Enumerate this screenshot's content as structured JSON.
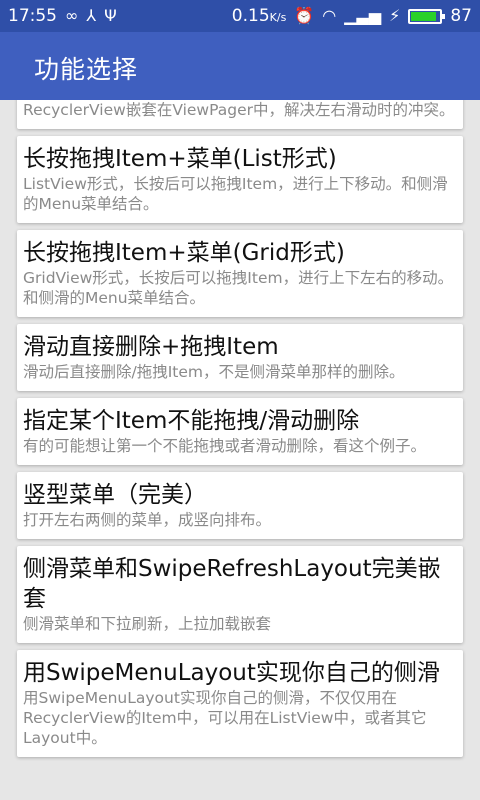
{
  "status_bar": {
    "time": "17:55",
    "net_speed": "0.15",
    "net_unit": "K/s",
    "battery_level": "87",
    "battery_fraction": 0.87
  },
  "toolbar": {
    "title": "功能选择"
  },
  "items": [
    {
      "title": "",
      "desc": "RecyclerView嵌套在ViewPager中，解决左右滑动时的冲突。"
    },
    {
      "title": "长按拖拽Item+菜单(List形式)",
      "desc": "ListView形式，长按后可以拖拽Item，进行上下移动。和侧滑的Menu菜单结合。"
    },
    {
      "title": "长按拖拽Item+菜单(Grid形式)",
      "desc": "GridView形式，长按后可以拖拽Item，进行上下左右的移动。和侧滑的Menu菜单结合。"
    },
    {
      "title": "滑动直接删除+拖拽Item",
      "desc": "滑动后直接删除/拖拽Item，不是侧滑菜单那样的删除。"
    },
    {
      "title": "指定某个Item不能拖拽/滑动删除",
      "desc": "有的可能想让第一个不能拖拽或者滑动删除，看这个例子。"
    },
    {
      "title": "竖型菜单（完美）",
      "desc": "打开左右两侧的菜单，成竖向排布。"
    },
    {
      "title": "侧滑菜单和SwipeRefreshLayout完美嵌套",
      "desc": "侧滑菜单和下拉刷新，上拉加载嵌套"
    },
    {
      "title": "用SwipeMenuLayout实现你自己的侧滑",
      "desc": "用SwipeMenuLayout实现你自己的侧滑，不仅仅用在RecyclerView的Item中，可以用在ListView中，或者其它Layout中。"
    }
  ]
}
